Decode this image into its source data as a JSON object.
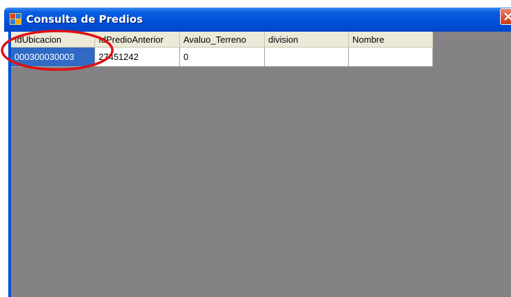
{
  "window": {
    "title": "Consulta de Predios",
    "icon": "app-grid-icon",
    "close_icon": "close-icon"
  },
  "grid": {
    "columns": [
      "IdUbicacion",
      "IdPredioAnterior",
      "Avaluo_Terreno",
      "division",
      "Nombre"
    ],
    "rows": [
      [
        "000300030003",
        "27451242",
        "0",
        "",
        ""
      ]
    ],
    "selected_cell": "000300030003"
  },
  "colors": {
    "titlebar": "#0050d8",
    "client_area": "#858285",
    "selection": "#316ac5",
    "header": "#ece9d8",
    "annotation_ellipse": "#e01010"
  }
}
